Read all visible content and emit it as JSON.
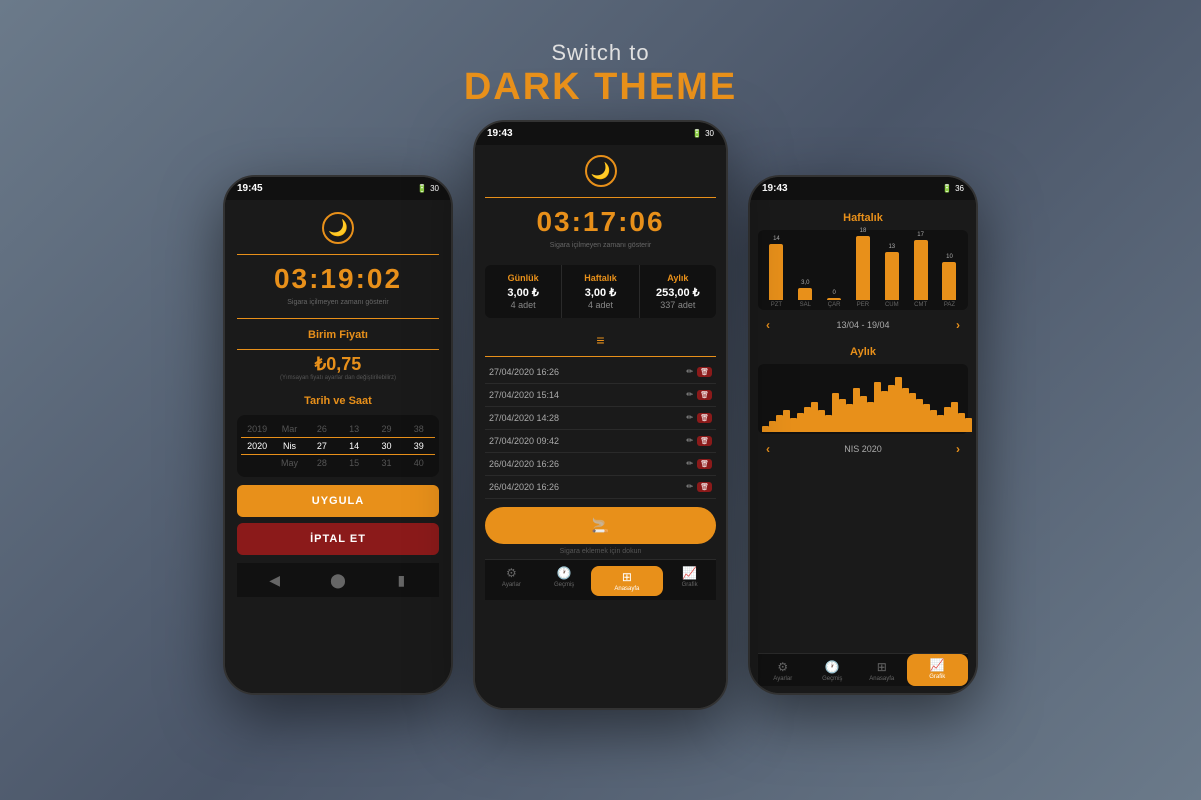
{
  "header": {
    "switch_to": "Switch to",
    "dark_theme": "DARK THEME"
  },
  "phone_left": {
    "status_time": "19:45",
    "timer": "03:19:02",
    "timer_sub": "Sigara içilmeyen zamanı gösterir",
    "section_birim": "Birim Fiyatı",
    "price": "₺0,75",
    "price_note": "(Yımsayan fiyatı ayarlar dan değiştirilebilirz)",
    "section_tarih": "Tarih ve Saat",
    "date_rows": [
      {
        "cells": [
          "2019",
          "Mar",
          "26",
          "13",
          "29",
          "38"
        ]
      },
      {
        "cells": [
          "2020",
          "Nis",
          "27",
          "14",
          "30",
          "39"
        ],
        "active": true
      },
      {
        "cells": [
          "May",
          "28",
          "15",
          "31",
          "40"
        ]
      }
    ],
    "btn_apply": "UYGULA",
    "btn_cancel": "İPTAL ET"
  },
  "phone_center": {
    "status_time": "19:43",
    "timer": "03:17:06",
    "timer_sub": "Sigara içilmeyen zamanı gösterir",
    "stats": [
      {
        "label": "Günlük",
        "value": "3,00 ₺",
        "count": "4 adet"
      },
      {
        "label": "Haftalık",
        "value": "3,00 ₺",
        "count": "4 adet"
      },
      {
        "label": "Aylık",
        "value": "253,00 ₺",
        "count": "337 adet"
      }
    ],
    "list_items": [
      "27/04/2020 16:26",
      "27/04/2020 15:14",
      "27/04/2020 14:28",
      "27/04/2020 09:42",
      "26/04/2020 16:26",
      "26/04/2020 16:26"
    ],
    "add_btn_label": "Sigara eklemek için dokun",
    "tabs": [
      {
        "label": "Ayarlar",
        "active": false
      },
      {
        "label": "Geçmiş",
        "active": false
      },
      {
        "label": "Anasayfa",
        "active": true
      },
      {
        "label": "Grafik",
        "active": false
      }
    ]
  },
  "phone_right": {
    "status_time": "19:43",
    "section_weekly": "Haftalık",
    "weekly_bars": [
      {
        "day": "PZT",
        "value": 14,
        "label": "14"
      },
      {
        "day": "SAL",
        "value": 3,
        "label": "3,0"
      },
      {
        "day": "ÇAR",
        "value": 0,
        "label": "0"
      },
      {
        "day": "PER",
        "value": 18,
        "label": "18"
      },
      {
        "day": "CUM",
        "value": 13,
        "label": "13"
      },
      {
        "day": "CMT",
        "value": 17,
        "label": "17°"
      },
      {
        "day": "PAZ",
        "value": 10,
        "label": "10"
      }
    ],
    "week_nav": "13/04 - 19/04",
    "section_monthly": "Aylık",
    "monthly_bars": [
      2,
      4,
      6,
      8,
      5,
      7,
      9,
      11,
      8,
      6,
      14,
      12,
      10,
      16,
      13,
      11,
      18,
      15,
      17,
      20,
      16,
      14,
      12,
      10,
      8,
      6,
      9,
      11,
      7,
      5
    ],
    "month_nav": "NIS 2020",
    "tabs": [
      {
        "label": "Ayarlar",
        "active": false
      },
      {
        "label": "Geçmiş",
        "active": false
      },
      {
        "label": "Anasayfa",
        "active": false
      },
      {
        "label": "Grafik",
        "active": true
      }
    ]
  }
}
